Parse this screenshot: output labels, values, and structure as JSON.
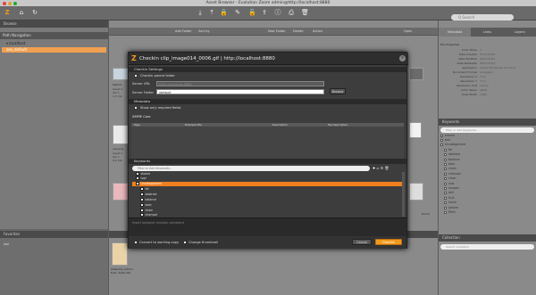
{
  "window": {
    "title": "Asset Browser - Evolution Zoom admin@http://localhost:8880"
  },
  "toolbar": {
    "add_folder": "Add Folder",
    "sort_by": "Sort by",
    "new_folder": "New Folder",
    "delete": "Delete",
    "action": "Action",
    "search_placeholder": "Q Search"
  },
  "left": {
    "browse_label": "Browse",
    "nav_header": "Path Navigation",
    "tree": [
      {
        "label": "▾ localhost"
      },
      {
        "label": "zoo_default"
      }
    ],
    "favorites_header": "Favorites",
    "favorites_item": "ooii"
  },
  "center": {
    "files": [
      {
        "label": "Switch...",
        "sub": "Asset 3\nVer 1\n1.5 mb"
      },
      {
        "label": "ooii.png",
        "sub": "Asset 1\nVer 1\n0.0 mb"
      }
    ],
    "open_button": "Open",
    "found_label": "found",
    "added_by": "Added by admin\nfolio: Swan Nix"
  },
  "right": {
    "tabs": [
      {
        "label": "Metadata"
      },
      {
        "label": "Links"
      },
      {
        "label": "Layers"
      }
    ],
    "meta_section": "File Properties",
    "meta_rows": [
      {
        "k": "Color Mode",
        "v": "3"
      },
      {
        "k": "Date Created",
        "v": "05/17/2014"
      },
      {
        "k": "Date Modified",
        "v": "08/27/2014"
      },
      {
        "k": "Date Metadata",
        "v": "08/27/2014"
      },
      {
        "k": "Application",
        "v": "Adobe Photoshop CC 2014"
      },
      {
        "k": "Document Format",
        "v": "Untagged"
      },
      {
        "k": "Resolution X",
        "v": "72.0"
      },
      {
        "k": "Resolution Y",
        "v": "72.0"
      },
      {
        "k": "Resolution Unit",
        "v": "inches"
      },
      {
        "k": "Color Space",
        "v": "sRGB"
      },
      {
        "k": "Pixel Width",
        "v": "1080"
      }
    ],
    "keywords_header": "Keywords",
    "kw_search": "Filter or Add Keywords...",
    "keywords": [
      {
        "label": "shame"
      },
      {
        "label": "tool"
      },
      {
        "label": "Uncategorized"
      },
      {
        "label": "fbl"
      },
      {
        "label": "abstract"
      },
      {
        "label": "balance"
      },
      {
        "label": "bear"
      },
      {
        "label": "chain"
      },
      {
        "label": "charcoal"
      },
      {
        "label": "clean"
      },
      {
        "label": "cow"
      },
      {
        "label": "coupon"
      },
      {
        "label": "drill"
      },
      {
        "label": "fruit"
      },
      {
        "label": "horse"
      },
      {
        "label": "iphone"
      },
      {
        "label": "Rikki"
      }
    ],
    "collection_header": "Collection",
    "collection_search": "Search Collection"
  },
  "dialog": {
    "title": "Checkin clip_image014_0006.gif | http://localhost:8880",
    "checkin_settings": "Checkin Settings",
    "checkin_parent": "Checkin parent folder",
    "server_url_label": "Server URL",
    "server_url_value": "http://localhost:8880",
    "server_folder_label": "Server Folder",
    "server_folder_value": "/default",
    "browse": "Browse",
    "metadata_header": "Metadata",
    "show_required": "Show only required fields",
    "xmp_label": "XMPIE Core",
    "table_cols": {
      "tags": "Tags",
      "example": "Example File",
      "desc": "Description",
      "mydesc": "My Description"
    },
    "keywords_header": "Keywords",
    "kw_placeholder": "Filter or Add Keywords...",
    "kw_rows": [
      {
        "label": "shame",
        "sel": false
      },
      {
        "label": "tool",
        "sel": false
      },
      {
        "label": "Uncategorized",
        "sel": true
      },
      {
        "label": "fbl",
        "sel": false
      },
      {
        "label": "abstract",
        "sel": false
      },
      {
        "label": "balance",
        "sel": false
      },
      {
        "label": "bear",
        "sel": false
      },
      {
        "label": "chain",
        "sel": false
      },
      {
        "label": "charcoal",
        "sel": false
      }
    ],
    "comment_placeholder": "Insert optional revision comment",
    "convert_copy": "Convert to working copy",
    "change_thumb": "Change thumbnail",
    "cancel": "Cancel",
    "checkin": "Checkin"
  },
  "colors": {
    "accent": "#f07f1f",
    "dialog_bg": "#3d3d3d"
  }
}
